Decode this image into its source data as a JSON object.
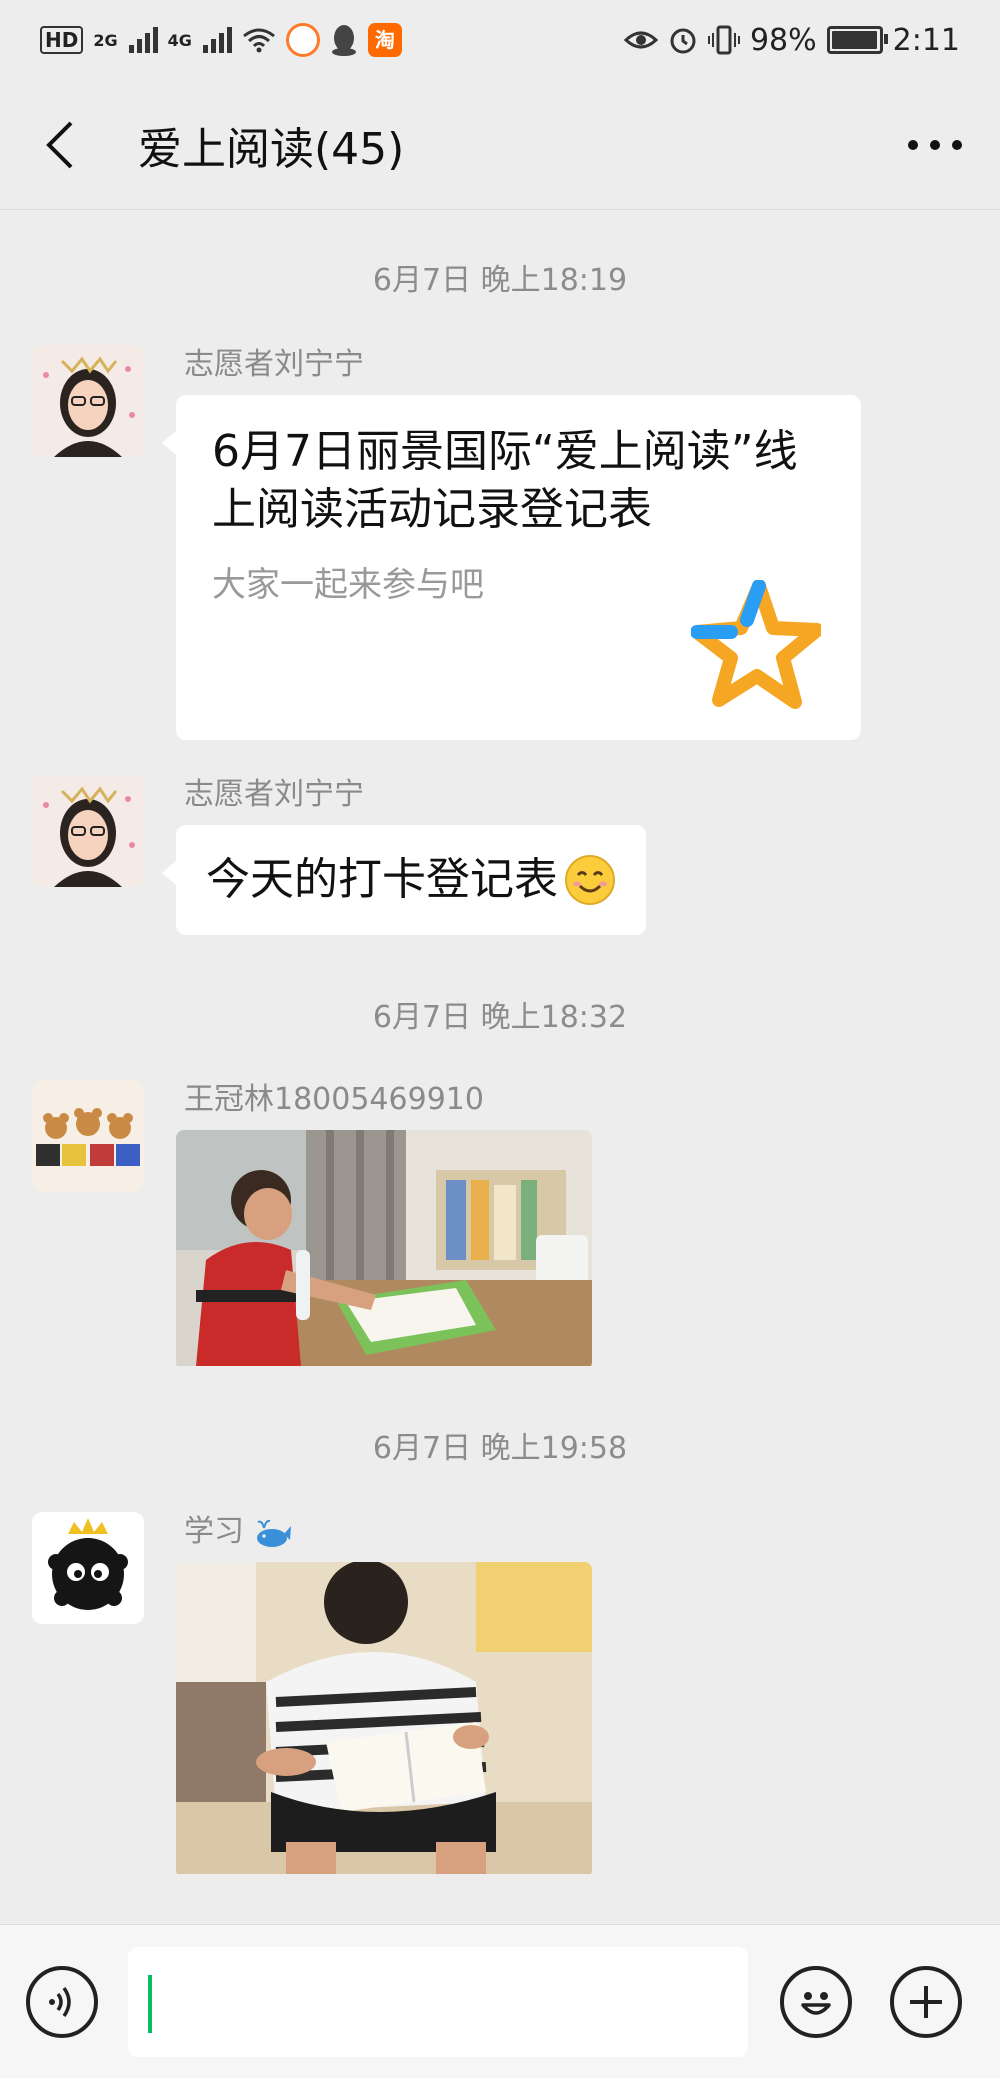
{
  "status_bar": {
    "hd_label": "HD",
    "net_2g": "2G",
    "net_4g": "4G",
    "battery_text": "98%",
    "battery_level": 0.98,
    "time": "2:11",
    "taobao_glyph": "淘"
  },
  "header": {
    "title": "爱上阅读(45)"
  },
  "timestamps": [
    "6月7日 晚上18:19",
    "6月7日 晚上18:32",
    "6月7日 晚上19:58"
  ],
  "messages": [
    {
      "sender": "志愿者刘宁宁",
      "type": "card",
      "card_title": "6月7日丽景国际“爱上阅读”线上阅读活动记录登记表",
      "card_desc": "大家一起来参与吧",
      "card_icon": "star-icon"
    },
    {
      "sender": "志愿者刘宁宁",
      "type": "text",
      "text": "今天的打卡登记表",
      "emoji": "smiling-face-icon"
    },
    {
      "sender": "王冠林18005469910",
      "type": "image",
      "image": "boy-reading-at-desk-photo"
    },
    {
      "sender": "学习",
      "sender_emoji": "whale-icon",
      "type": "image",
      "image": "boy-reading-book-photo"
    }
  ],
  "input_bar": {
    "value": "",
    "voice_icon": "voice-icon",
    "emoji_icon": "emoji-icon",
    "plus_icon": "plus-icon"
  },
  "colors": {
    "background": "#ededed",
    "bubble": "#ffffff",
    "caret": "#07c160",
    "star_orange": "#f5a623",
    "star_blue": "#2a9df4"
  }
}
